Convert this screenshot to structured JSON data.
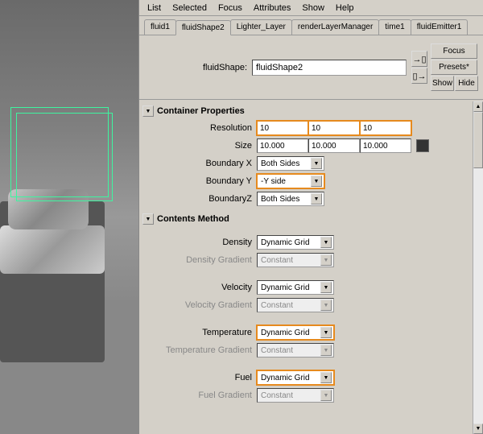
{
  "menu": {
    "list": "List",
    "selected": "Selected",
    "focus": "Focus",
    "attributes": "Attributes",
    "show": "Show",
    "help": "Help"
  },
  "tabs": [
    "fluid1",
    "fluidShape2",
    "Lighter_Layer",
    "renderLayerManager",
    "time1",
    "fluidEmitter1"
  ],
  "header": {
    "label": "fluidShape:",
    "value": "fluidShape2",
    "btn_focus": "Focus",
    "btn_presets": "Presets*",
    "btn_show": "Show",
    "btn_hide": "Hide"
  },
  "sections": {
    "container": {
      "title": "Container Properties",
      "resolution": {
        "label": "Resolution",
        "x": "10",
        "y": "10",
        "z": "10"
      },
      "size": {
        "label": "Size",
        "x": "10.000",
        "y": "10.000",
        "z": "10.000"
      },
      "boundary_x": {
        "label": "Boundary X",
        "value": "Both Sides"
      },
      "boundary_y": {
        "label": "Boundary Y",
        "value": "-Y side"
      },
      "boundary_z": {
        "label": "BoundaryZ",
        "value": "Both Sides"
      }
    },
    "contents": {
      "title": "Contents Method",
      "density": {
        "label": "Density",
        "value": "Dynamic Grid"
      },
      "density_grad": {
        "label": "Density Gradient",
        "value": "Constant"
      },
      "velocity": {
        "label": "Velocity",
        "value": "Dynamic Grid"
      },
      "velocity_grad": {
        "label": "Velocity Gradient",
        "value": "Constant"
      },
      "temperature": {
        "label": "Temperature",
        "value": "Dynamic Grid"
      },
      "temperature_grad": {
        "label": "Temperature Gradient",
        "value": "Constant"
      },
      "fuel": {
        "label": "Fuel",
        "value": "Dynamic Grid"
      },
      "fuel_grad": {
        "label": "Fuel Gradient",
        "value": "Constant"
      }
    }
  }
}
